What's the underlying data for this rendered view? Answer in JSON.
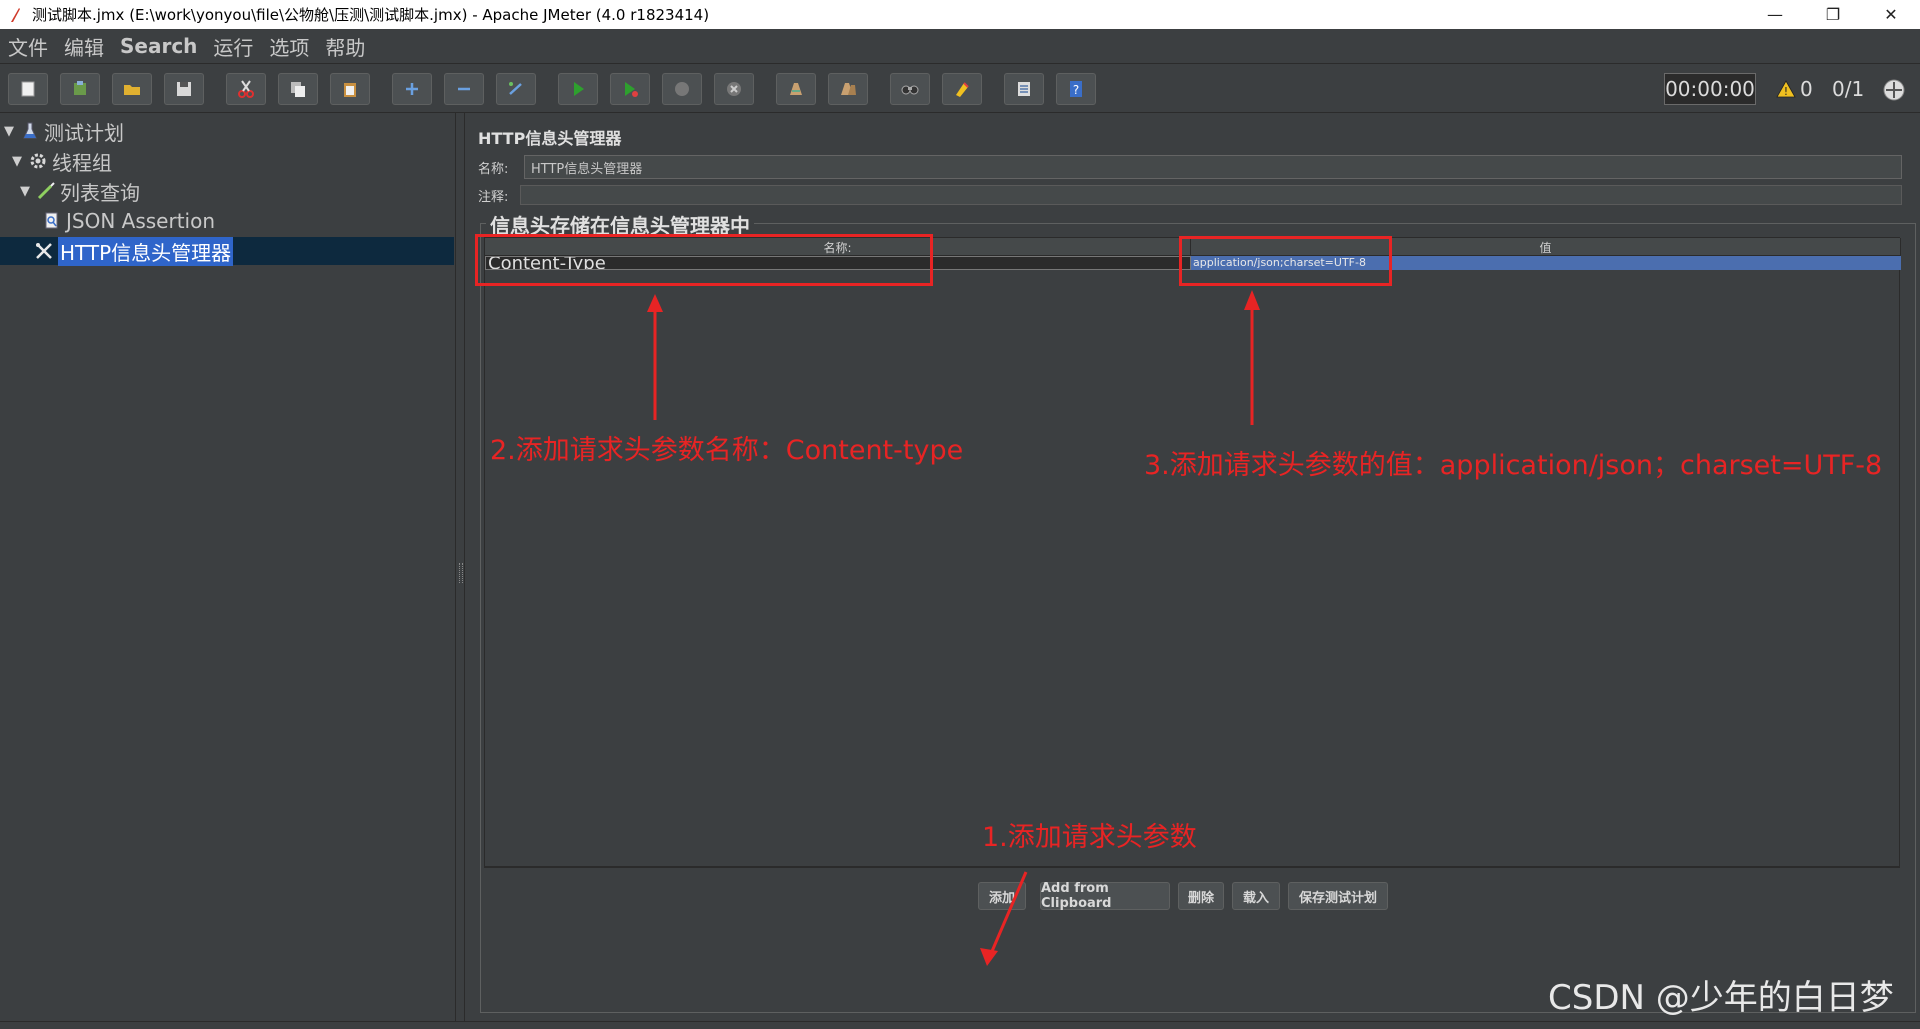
{
  "window": {
    "title": "测试脚本.jmx (E:\\work\\yonyou\\file\\公物舱\\压测\\测试脚本.jmx) - Apache JMeter (4.0 r1823414)",
    "minimize": "—",
    "maximize": "❐",
    "close": "✕"
  },
  "menu": {
    "items": [
      "文件",
      "编辑",
      "Search",
      "运行",
      "选项",
      "帮助"
    ]
  },
  "toolbar": {
    "timer": "00:00:00",
    "warnings": "0",
    "threads": "0/1",
    "buttons": [
      "new-icon",
      "templates-icon",
      "open-icon",
      "save-icon",
      "cut-icon",
      "copy-icon",
      "paste-icon",
      "expand-icon",
      "collapse-icon",
      "toggle-icon",
      "start-icon",
      "start-no-pause-icon",
      "stop-icon",
      "shutdown-icon",
      "clear-icon",
      "clear-all-icon",
      "search-icon",
      "reset-search-icon",
      "function-helper-icon",
      "help-icon"
    ]
  },
  "tree": {
    "items": [
      {
        "label": "测试计划",
        "icon": "test-plan-icon",
        "expanded": true
      },
      {
        "label": "线程组",
        "icon": "thread-group-icon",
        "expanded": true
      },
      {
        "label": "列表查询",
        "icon": "sampler-icon",
        "expanded": true
      },
      {
        "label": "JSON Assertion",
        "icon": "assertion-icon"
      },
      {
        "label": "HTTP信息头管理器",
        "icon": "config-icon",
        "selected": true
      }
    ]
  },
  "panel": {
    "title": "HTTP信息头管理器",
    "name_label": "名称:",
    "name_value": "HTTP信息头管理器",
    "comment_label": "注释:",
    "group_title": "信息头存储在信息头管理器中",
    "table": {
      "columns": [
        "名称:",
        "值"
      ],
      "rows": [
        {
          "name": "Content-Type",
          "value": "application/json;charset=UTF-8"
        }
      ]
    },
    "buttons": {
      "add": "添加",
      "add_clipboard": "Add from Clipboard",
      "delete": "删除",
      "load": "载入",
      "save_plan": "保存测试计划"
    }
  },
  "annotations": {
    "step1": "1.添加请求头参数",
    "step2": "2.添加请求头参数名称：Content-type",
    "step3": "3.添加请求头参数的值：application/json；charset=UTF-8",
    "color": "#e82424"
  },
  "watermark": "CSDN @少年的白日梦"
}
